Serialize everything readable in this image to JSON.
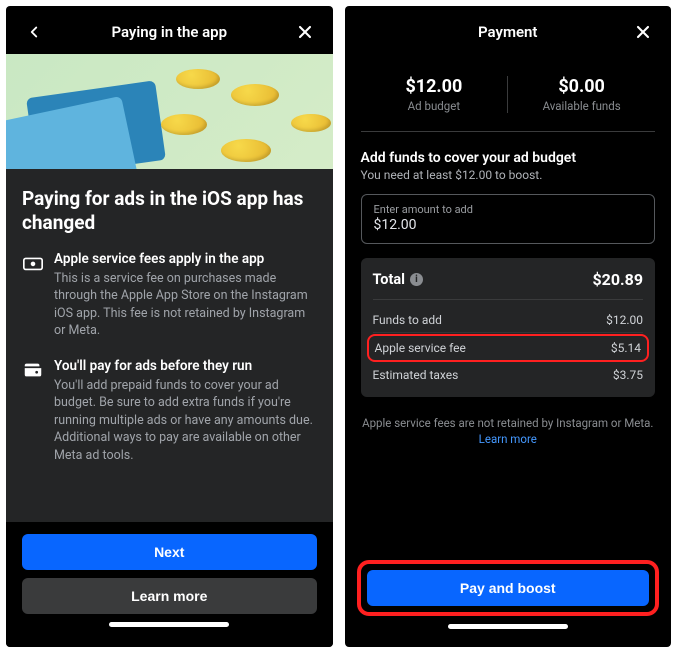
{
  "left": {
    "header_title": "Paying in the app",
    "heading": "Paying for ads in the iOS app has changed",
    "info1_title": "Apple service fees apply in the app",
    "info1_desc": "This is a service fee on purchases made through the Apple App Store on the Instagram iOS app. This fee is not retained by Instagram or Meta.",
    "info2_title": "You'll pay for ads before they run",
    "info2_desc": "You'll add prepaid funds to cover your ad budget. Be sure to add extra funds if you're running multiple ads or have any amounts due. Additional ways to pay are available on other Meta ad tools.",
    "next_label": "Next",
    "learn_more_label": "Learn more"
  },
  "right": {
    "header_title": "Payment",
    "budget_amount": "$12.00",
    "budget_label": "Ad budget",
    "funds_amount": "$0.00",
    "funds_label": "Available funds",
    "add_title": "Add funds to cover your ad budget",
    "add_sub": "You need at least $12.00 to boost.",
    "amount_label": "Enter amount to add",
    "amount_value": "$12.00",
    "total_label": "Total",
    "total_value": "$20.89",
    "line1_label": "Funds to add",
    "line1_value": "$12.00",
    "line2_label": "Apple service fee",
    "line2_value": "$5.14",
    "line3_label": "Estimated taxes",
    "line3_value": "$3.75",
    "fee_note_text": "Apple service fees are not retained by Instagram or Meta. ",
    "fee_note_link": "Learn more",
    "pay_label": "Pay and boost"
  }
}
